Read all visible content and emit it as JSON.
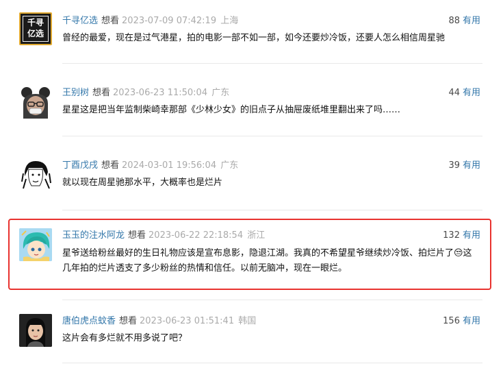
{
  "comments": [
    {
      "user": "千寻亿选",
      "status": "想看",
      "time": "2023-07-09 07:42:19",
      "location": "上海",
      "votes": "88",
      "useful": "有用",
      "text": "曾经的最爱，现在是过气港星，拍的电影一部不如一部，如今还要炒冷饭，还要人怎么相信周星驰",
      "avatar_text": [
        "千寻",
        "亿选"
      ]
    },
    {
      "user": "王别树",
      "status": "想看",
      "time": "2023-06-23 11:50:04",
      "location": "广东",
      "votes": "44",
      "useful": "有用",
      "text": "星星这是把当年监制柴崎幸那部《少林少女》的旧点子从抽屉废纸堆里翻出来了吗……"
    },
    {
      "user": "丁酉戊戌",
      "status": "想看",
      "time": "2024-03-01 19:56:04",
      "location": "广东",
      "votes": "39",
      "useful": "有用",
      "text": "就以现在周星驰那水平，大概率也是烂片"
    },
    {
      "user": "玉玉的注水阿龙",
      "status": "想看",
      "time": "2023-06-22 22:18:54",
      "location": "浙江",
      "votes": "132",
      "useful": "有用",
      "text": "星爷送给粉丝最好的生日礼物应该是宣布息影，隐退江湖。我真的不希望星爷继续炒冷饭、拍烂片了😒这几年拍的烂片透支了多少粉丝的热情和信任。以前无脑冲，现在一眼烂。"
    },
    {
      "user": "唐伯虎点蚊香",
      "status": "想看",
      "time": "2023-06-23 01:51:41",
      "location": "韩国",
      "votes": "156",
      "useful": "有用",
      "text": "这片会有多烂就不用多说了吧？"
    }
  ],
  "colors": {
    "link": "#3377aa",
    "highlight": "#e8322e",
    "meta": "#aaaaaa"
  }
}
